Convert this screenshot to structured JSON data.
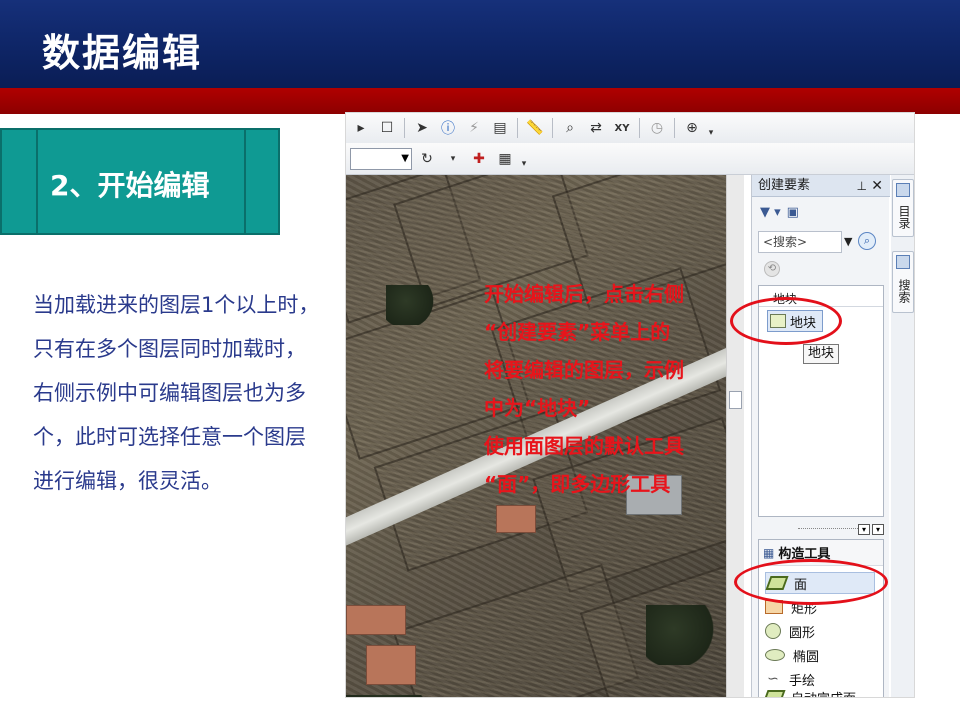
{
  "slide": {
    "title": "数据编辑",
    "step": "2、开始编辑",
    "description": "当加载进来的图层1个以上时，只有在多个图层同时加载时，右侧示例中可编辑图层也为多个，此时可选择任意一个图层进行编辑，很灵活。"
  },
  "annotation": {
    "lines": [
      "开始编辑后，点击右侧",
      "“创建要素”菜单上的",
      "将要编辑的图层，示例",
      "中为“地块”",
      "使用面图层的默认工具",
      "“面”，即多边形工具"
    ]
  },
  "panel": {
    "title": "创建要素",
    "search_placeholder": "<搜索>",
    "group_header": "地块",
    "template_item": "地块",
    "tooltip": "地块",
    "construct_header": "构造工具",
    "tools": [
      "面",
      "矩形",
      "圆形",
      "椭圆",
      "手绘",
      "自动完成面"
    ]
  },
  "side_tabs": [
    "目录",
    "搜索"
  ],
  "colors": {
    "header_blue": "#0e2566",
    "header_red": "#a00000",
    "step_teal": "#0f9a93",
    "annotation_red": "#e8141b",
    "body_text": "#2a3a8c"
  }
}
